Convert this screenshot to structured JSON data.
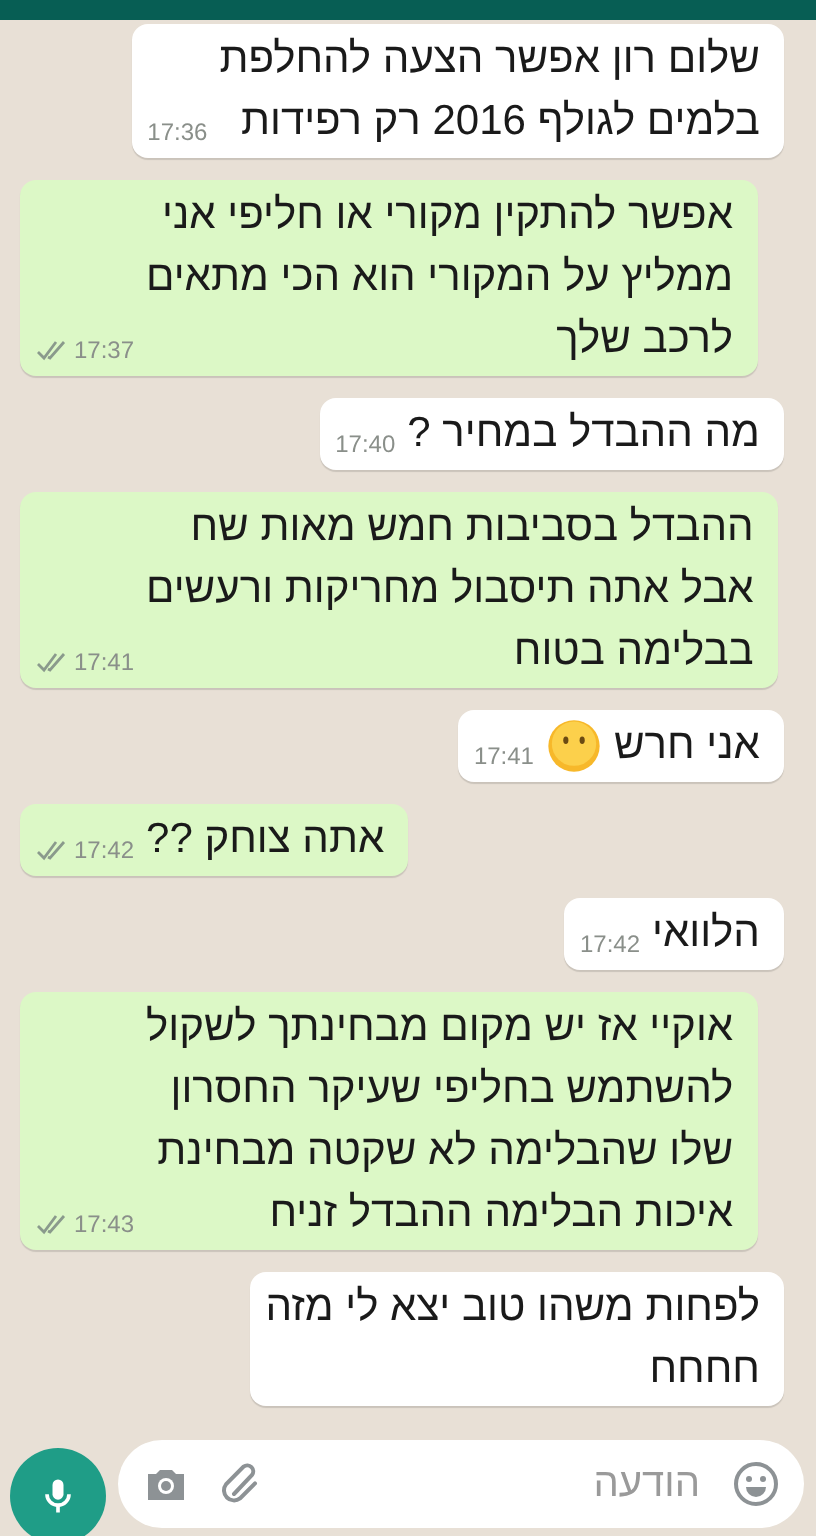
{
  "messages": [
    {
      "outgoing": false,
      "text": "שלום רון אפשר הצעה להחלפת\nבלמים לגולף 2016 רק רפידות",
      "time": "17:36"
    },
    {
      "outgoing": true,
      "text": "אפשר להתקין מקורי או חליפי אני\nממליץ על המקורי הוא הכי מתאים\nלרכב שלך",
      "time": "17:37",
      "read": false
    },
    {
      "outgoing": false,
      "text": "מה ההבדל במחיר ?",
      "time": "17:40"
    },
    {
      "outgoing": true,
      "text": "ההבדל בסביבות חמש מאות שח\nאבל אתה תיסבול מחריקות ורעשים\nבבלימה בטוח",
      "time": "17:41",
      "read": false
    },
    {
      "outgoing": false,
      "text": "אני חרש",
      "has_emoji": true,
      "time": "17:41"
    },
    {
      "outgoing": true,
      "text": "אתה צוחק ??",
      "time": "17:42",
      "read": false
    },
    {
      "outgoing": false,
      "text": "הלוואי",
      "time": "17:42"
    },
    {
      "outgoing": true,
      "text": "אוקיי אז יש מקום מבחינתך לשקול\nלהשתמש בחליפי שעיקר החסרון\nשלו שהבלימה לא שקטה מבחינת\nאיכות הבלימה ההבדל זניח",
      "time": "17:43",
      "read": false
    },
    {
      "outgoing": false,
      "text": "לפחות משהו טוב יצא לי מזה\nחחחח"
    }
  ],
  "composer": {
    "placeholder": "הודעה"
  }
}
